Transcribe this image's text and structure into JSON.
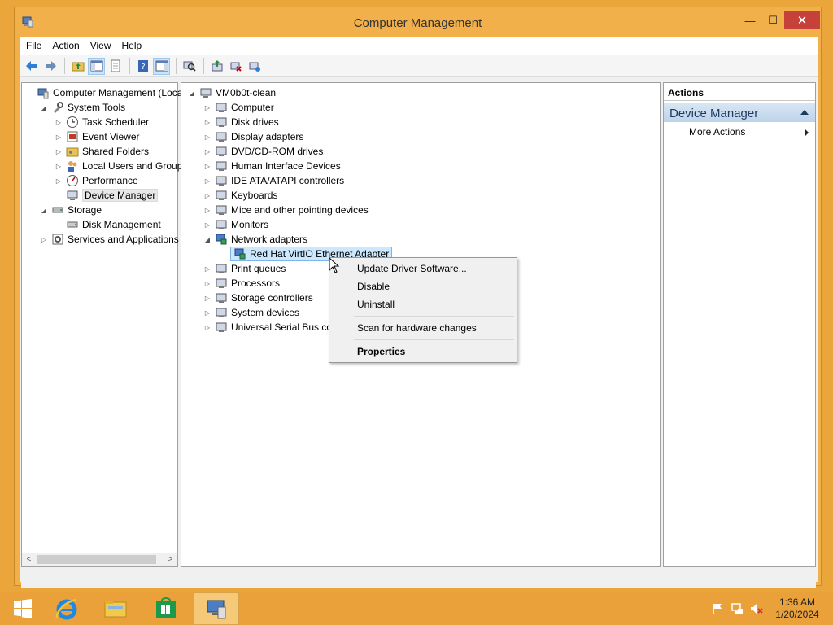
{
  "window": {
    "title": "Computer Management",
    "minimize": "—",
    "maximize": "☐",
    "close": "✕"
  },
  "menubar": [
    "File",
    "Action",
    "View",
    "Help"
  ],
  "left_tree": [
    {
      "label": "Computer Management (Local",
      "indent": 0,
      "expander": "",
      "icon": "computer-management-icon"
    },
    {
      "label": "System Tools",
      "indent": 1,
      "expander": "◢",
      "icon": "system-tools-icon"
    },
    {
      "label": "Task Scheduler",
      "indent": 2,
      "expander": "▷",
      "icon": "task-scheduler-icon"
    },
    {
      "label": "Event Viewer",
      "indent": 2,
      "expander": "▷",
      "icon": "event-viewer-icon"
    },
    {
      "label": "Shared Folders",
      "indent": 2,
      "expander": "▷",
      "icon": "shared-folders-icon"
    },
    {
      "label": "Local Users and Groups",
      "indent": 2,
      "expander": "▷",
      "icon": "local-users-icon"
    },
    {
      "label": "Performance",
      "indent": 2,
      "expander": "▷",
      "icon": "performance-icon"
    },
    {
      "label": "Device Manager",
      "indent": 2,
      "expander": "",
      "icon": "device-manager-icon",
      "selected": true
    },
    {
      "label": "Storage",
      "indent": 1,
      "expander": "◢",
      "icon": "storage-icon"
    },
    {
      "label": "Disk Management",
      "indent": 2,
      "expander": "",
      "icon": "disk-management-icon"
    },
    {
      "label": "Services and Applications",
      "indent": 1,
      "expander": "▷",
      "icon": "services-icon"
    }
  ],
  "device_tree": {
    "root": "VM0b0t-clean",
    "items": [
      {
        "label": "Computer",
        "expander": "▷"
      },
      {
        "label": "Disk drives",
        "expander": "▷"
      },
      {
        "label": "Display adapters",
        "expander": "▷"
      },
      {
        "label": "DVD/CD-ROM drives",
        "expander": "▷"
      },
      {
        "label": "Human Interface Devices",
        "expander": "▷"
      },
      {
        "label": "IDE ATA/ATAPI controllers",
        "expander": "▷"
      },
      {
        "label": "Keyboards",
        "expander": "▷"
      },
      {
        "label": "Mice and other pointing devices",
        "expander": "▷"
      },
      {
        "label": "Monitors",
        "expander": "▷"
      },
      {
        "label": "Network adapters",
        "expander": "◢"
      },
      {
        "label": "Red Hat VirtIO Ethernet Adapter",
        "expander": "",
        "child": true,
        "selected": true
      },
      {
        "label": "Print queues",
        "expander": "▷"
      },
      {
        "label": "Processors",
        "expander": "▷"
      },
      {
        "label": "Storage controllers",
        "expander": "▷"
      },
      {
        "label": "System devices",
        "expander": "▷"
      },
      {
        "label": "Universal Serial Bus cor",
        "expander": "▷"
      }
    ]
  },
  "actions": {
    "header": "Actions",
    "section": "Device Manager",
    "more": "More Actions"
  },
  "context_menu": {
    "update": "Update Driver Software...",
    "disable": "Disable",
    "uninstall": "Uninstall",
    "scan": "Scan for hardware changes",
    "properties": "Properties"
  },
  "taskbar": {
    "time": "1:36 AM",
    "date": "1/20/2024"
  },
  "colors": {
    "accent": "#eba13a",
    "close": "#c7413b",
    "selection": "#cce8ff"
  }
}
